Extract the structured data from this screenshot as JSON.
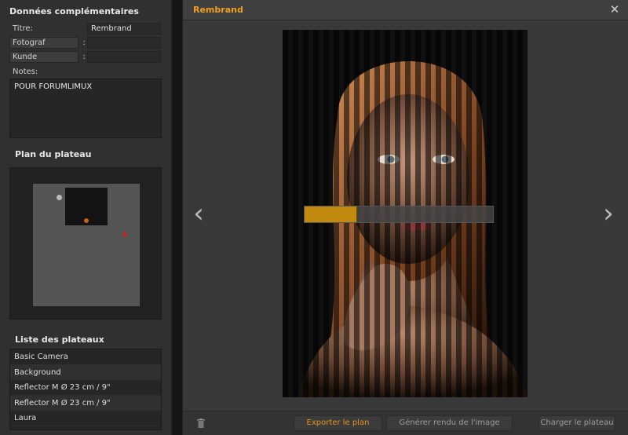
{
  "left_panel": {
    "section_title": "Données complémentaires",
    "fields": {
      "titre_label": "Titre:",
      "titre_value": "Rembrand",
      "fotograf_label": "Fotograf",
      "fotograf_value": "",
      "kunde_label": "Kunde",
      "kunde_value": "",
      "colon": ":"
    },
    "notes_label": "Notes:",
    "notes_value": "POUR FORUMLIMUX",
    "plan_title": "Plan du plateau",
    "list_title": "Liste des plateaux",
    "list_items": [
      "Basic Camera",
      "Background",
      "Reflector M Ø 23 cm / 9\"",
      "Reflector M Ø 23 cm / 9\"",
      "Laura"
    ]
  },
  "window": {
    "title": "Rembrand",
    "close_icon": "close-icon",
    "prev_icon": "chevron-left-icon",
    "next_icon": "chevron-right-icon",
    "progress_fraction": 0.28,
    "buttons": {
      "export": "Exporter le plan",
      "render": "Générer rendu de l'image",
      "load": "Charger le plateau"
    },
    "trash_icon": "trash-icon",
    "colors": {
      "accent": "#f0a020",
      "progress": "#c28a0f"
    }
  }
}
